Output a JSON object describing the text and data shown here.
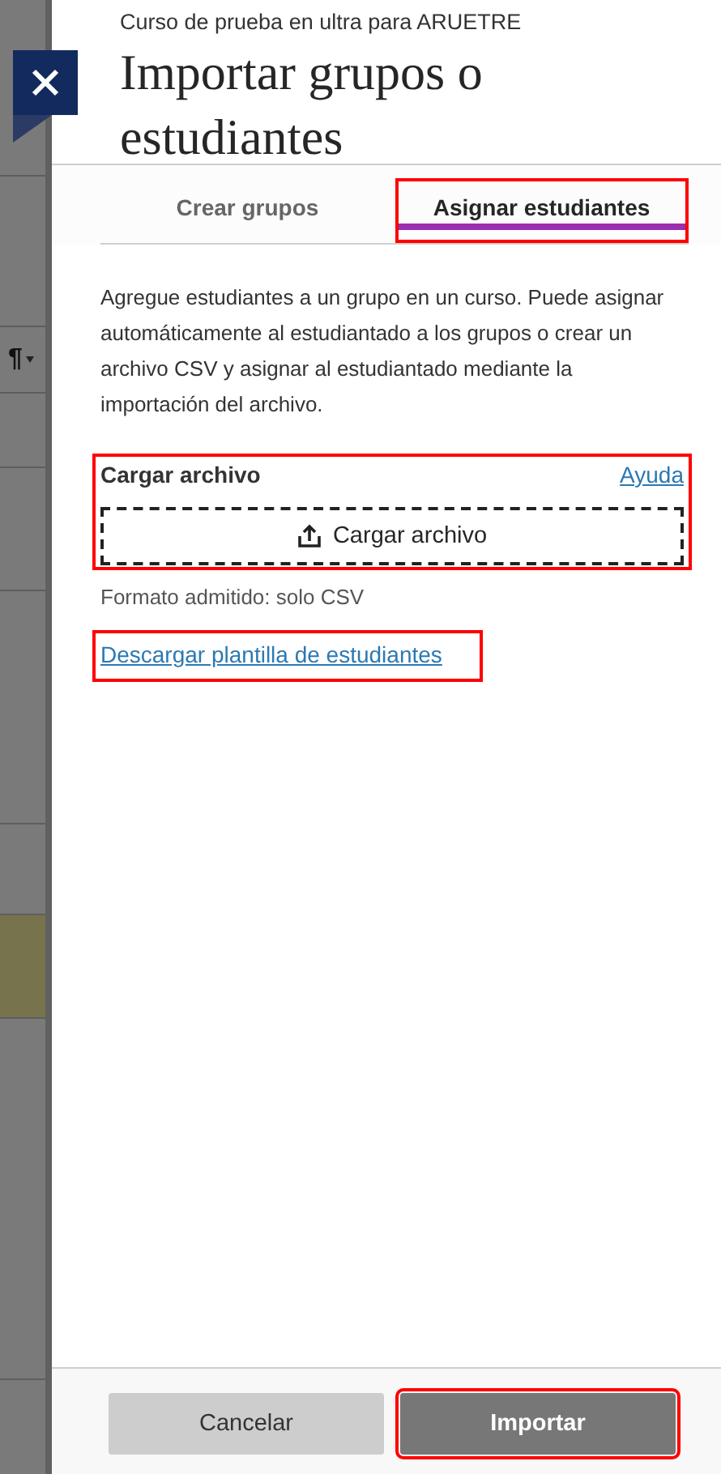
{
  "background_page": {
    "toolbar_symbol": "¶"
  },
  "panel": {
    "course": "Curso de prueba en ultra para ARUETRE",
    "title": "Importar grupos o estudiantes"
  },
  "tabs": [
    {
      "label": "Crear grupos",
      "selected": false,
      "highlighted": false
    },
    {
      "label": "Asignar estudiantes",
      "selected": true,
      "highlighted": true
    }
  ],
  "description": "Agregue estudiantes a un grupo en un curso. Puede asignar automáticamente al estudiantado a los grupos o crear un archivo CSV y asignar al estudiantado mediante la importación del archivo.",
  "upload": {
    "label": "Cargar archivo",
    "help_link": "Ayuda",
    "button": "Cargar archivo",
    "highlighted": true
  },
  "format_note": "Formato admitido: solo CSV",
  "template_link": {
    "label": "Descargar plantilla de estudiantes",
    "highlighted": true
  },
  "buttons": [
    {
      "label": "Cancelar",
      "kind": "secondary",
      "highlighted": false
    },
    {
      "label": "Importar",
      "kind": "primary",
      "highlighted": true
    }
  ]
}
